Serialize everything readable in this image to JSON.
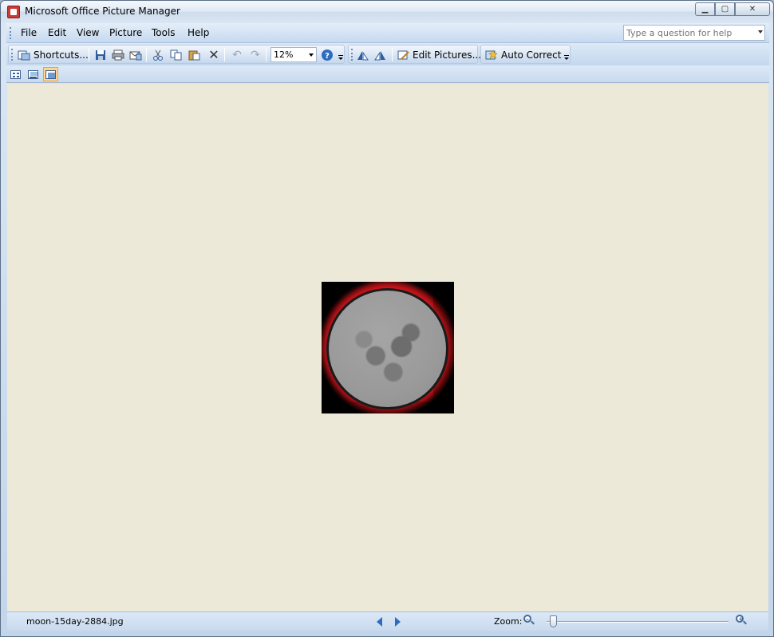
{
  "window": {
    "title": "Microsoft Office Picture Manager",
    "controls": {
      "minimize": "▁",
      "maximize": "▢",
      "close": "✕"
    }
  },
  "menu": {
    "items": [
      "File",
      "Edit",
      "View",
      "Picture",
      "Tools",
      "Help"
    ],
    "help_placeholder": "Type a question for help"
  },
  "toolbar": {
    "shortcuts_label": "Shortcuts...",
    "zoom_value": "12%",
    "edit_pictures_label": "Edit Pictures...",
    "auto_correct_label": "Auto Correct",
    "icons": [
      "save-icon",
      "print-icon",
      "email-icon",
      "cut-icon",
      "copy-icon",
      "paste-icon",
      "delete-icon",
      "undo-icon",
      "redo-icon",
      "help-icon",
      "rotate-left-icon",
      "rotate-right-icon"
    ]
  },
  "viewbar": {
    "views": [
      "thumbnail-view",
      "filmstrip-view",
      "single-picture-view"
    ],
    "active": "single-picture-view"
  },
  "main": {
    "image_subject": "moon photograph"
  },
  "status": {
    "filename": "moon-15day-2884.jpg",
    "zoom_label": "Zoom:",
    "zoom_level": 0.02
  },
  "colors": {
    "canvas_bg": "#ece9d8",
    "accent_blue": "#2f6cc0",
    "active_view": "#ffd590"
  }
}
